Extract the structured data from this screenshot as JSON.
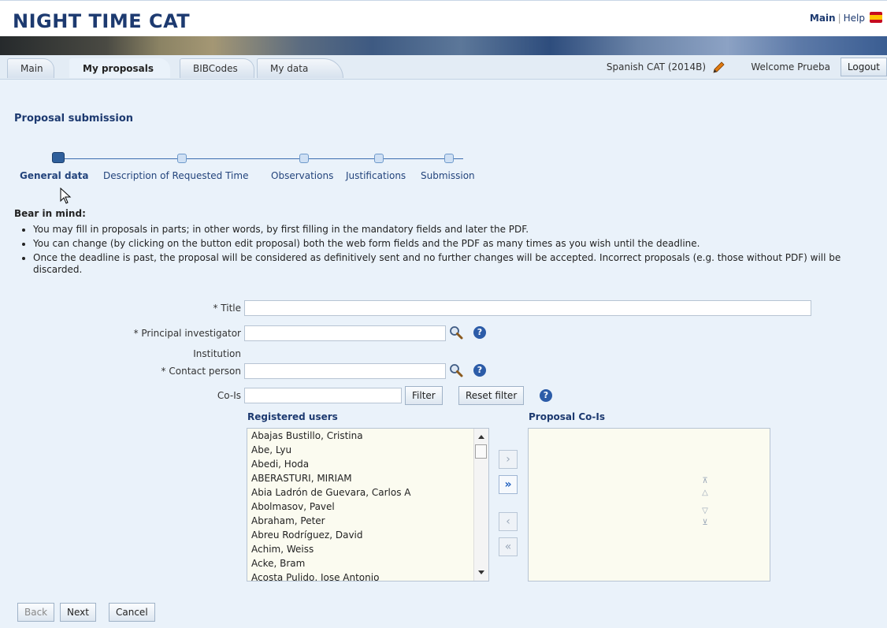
{
  "app": {
    "title": "NIGHT TIME CAT"
  },
  "top_links": {
    "main": "Main",
    "separator": "|",
    "help": "Help"
  },
  "tabs": [
    {
      "label": "Main",
      "active": false
    },
    {
      "label": "My proposals",
      "active": true
    },
    {
      "label": "BIBCodes",
      "active": false
    },
    {
      "label": "My data",
      "active": false
    }
  ],
  "header_right": {
    "semester": "Spanish CAT  (2014B)",
    "welcome": "Welcome Prueba",
    "logout": "Logout"
  },
  "page_title": "Proposal submission",
  "steps": [
    {
      "label": "General data",
      "active": true
    },
    {
      "label": "Description of Requested Time",
      "active": false
    },
    {
      "label": "Observations",
      "active": false
    },
    {
      "label": "Justifications",
      "active": false
    },
    {
      "label": "Submission",
      "active": false
    }
  ],
  "bear_in_mind": {
    "title": "Bear in mind:",
    "items": [
      "You may fill in proposals in parts; in other words, by first filling in the mandatory fields and later the PDF.",
      "You can change (by clicking on the button edit proposal) both the web form fields and the PDF as many times as you wish until the deadline.",
      "Once the deadline is past, the proposal will be considered as definitively sent and no further changes will be accepted. Incorrect proposals (e.g. those without PDF) will be discarded."
    ]
  },
  "form": {
    "title_label": "* Title",
    "title_value": "",
    "pi_label": "* Principal investigator",
    "pi_value": "",
    "institution_label": "Institution",
    "contact_label": "* Contact person",
    "contact_value": "",
    "cois_label": "Co-Is",
    "cois_value": "",
    "filter_button": "Filter",
    "reset_filter_button": "Reset filter"
  },
  "registered_users": {
    "title": "Registered users",
    "items": [
      "Abajas Bustillo, Cristina",
      "Abe, Lyu",
      "Abedi, Hoda",
      "ABERASTURI, MIRIAM",
      "Abia Ladrón de Guevara, Carlos A",
      "Abolmasov, Pavel",
      "Abraham, Peter",
      "Abreu Rodríguez, David",
      "Achim, Weiss",
      "Acke, Bram",
      "Acosta Pulido, Jose Antonio"
    ]
  },
  "proposal_cois": {
    "title": "Proposal Co-Is",
    "items": []
  },
  "move_buttons": {
    "add_one": "›",
    "add_all": "»",
    "remove_one": "‹",
    "remove_all": "«"
  },
  "order_buttons": {
    "top": "⊼",
    "up": "△",
    "down": "▽",
    "bottom": "⊻"
  },
  "footer": {
    "back": "Back",
    "next": "Next",
    "cancel": "Cancel"
  },
  "icons": {
    "flag": "spain-flag-icon",
    "pencil": "pencil-icon",
    "search": "magnifier-icon",
    "help": "help-icon"
  },
  "colors": {
    "title": "#1d3a70",
    "page_bg": "#eaf2fa",
    "accent": "#2f5f9b"
  }
}
